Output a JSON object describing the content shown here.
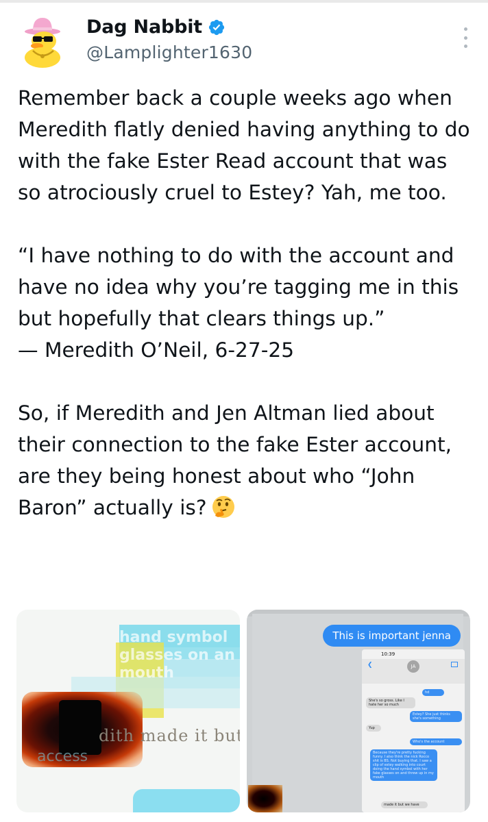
{
  "author": {
    "display_name": "Dag Nabbit",
    "handle": "@Lamplighter1630",
    "verified": true,
    "avatar_icon": "duck-with-sunglasses-icon",
    "verified_icon": "verified-badge-icon"
  },
  "more_icon": "more-vertical-icon",
  "tweet": {
    "paragraph1": "Remember back a couple weeks ago when Meredith flatly denied having anything to do with the fake Ester Read account that was so atrociously cruel to Estey? Yah, me too.",
    "quote": "“I have nothing to do with the account and have no idea why you’re tagging me in this but hopefully that clears things up.”",
    "attribution": "— Meredith O’Neil, 6-27-25",
    "paragraph3": "So, if Meredith and Jen Altman lied about their connection to the fake Ester account, are they being honest about who “John Baron” actually is?",
    "emoji_icon": "thinking-face-icon"
  },
  "media": {
    "left": {
      "overlay_text": "hand symbol glasses on an mouth",
      "caption": "dith made it but w",
      "caption2": "access"
    },
    "right": {
      "bubble_text": "This is important jenna",
      "phone_time": "10:39",
      "contact_initials": "JA",
      "messages": [
        {
          "dir": "out",
          "text": "hd"
        },
        {
          "dir": "in",
          "text": "She's so gross. Like I hate her so much"
        },
        {
          "dir": "out",
          "text": "Estey? She just thinks she's something"
        },
        {
          "dir": "in",
          "text": "Yup"
        },
        {
          "dir": "out",
          "text": "Who's the account"
        },
        {
          "dir": "out",
          "text": "Because they're pretty fucking funny. I also think the nick Rocco shit is BS. Not buying that. I saw a clip of estey walking into court doing the hand symbol with her fake glasses on and threw up in my mouth"
        },
        {
          "dir": "in",
          "text": "made it but we have"
        }
      ]
    }
  },
  "colors": {
    "accent_blue": "#1d9bf0",
    "text_primary": "#0f1419",
    "text_secondary": "#536471"
  }
}
